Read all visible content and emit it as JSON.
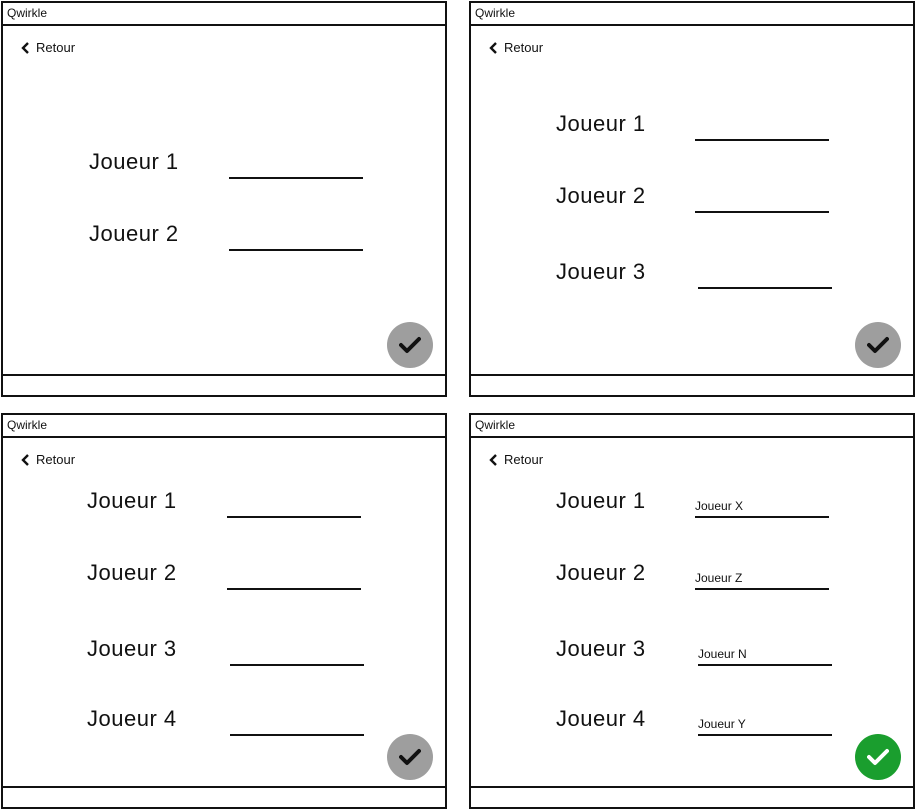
{
  "screens": [
    {
      "title": "Qwirkle",
      "back_label": "Retour",
      "rows": [
        {
          "label": "Joueur 1",
          "value": ""
        },
        {
          "label": "Joueur 2",
          "value": ""
        }
      ],
      "confirm": {
        "state": "disabled",
        "color": "#9e9e9e",
        "check_color": "#111111",
        "icon": "check-icon"
      }
    },
    {
      "title": "Qwirkle",
      "back_label": "Retour",
      "rows": [
        {
          "label": "Joueur 1",
          "value": ""
        },
        {
          "label": "Joueur 2",
          "value": ""
        },
        {
          "label": "Joueur 3",
          "value": ""
        }
      ],
      "confirm": {
        "state": "disabled",
        "color": "#9e9e9e",
        "check_color": "#111111",
        "icon": "check-icon"
      }
    },
    {
      "title": "Qwirkle",
      "back_label": "Retour",
      "rows": [
        {
          "label": "Joueur 1",
          "value": ""
        },
        {
          "label": "Joueur 2",
          "value": ""
        },
        {
          "label": "Joueur 3",
          "value": ""
        },
        {
          "label": "Joueur 4",
          "value": ""
        }
      ],
      "confirm": {
        "state": "disabled",
        "color": "#9e9e9e",
        "check_color": "#111111",
        "icon": "check-icon"
      }
    },
    {
      "title": "Qwirkle",
      "back_label": "Retour",
      "rows": [
        {
          "label": "Joueur 1",
          "value": "Joueur X"
        },
        {
          "label": "Joueur 2",
          "value": "Joueur Z"
        },
        {
          "label": "Joueur 3",
          "value": "Joueur N"
        },
        {
          "label": "Joueur 4",
          "value": "Joueur Y"
        }
      ],
      "confirm": {
        "state": "enabled",
        "color": "#1a9e2e",
        "check_color": "#ffffff",
        "icon": "check-icon"
      }
    }
  ]
}
